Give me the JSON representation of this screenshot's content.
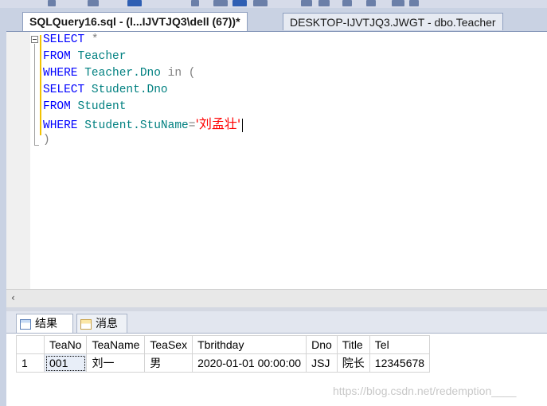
{
  "editor_tabs": [
    {
      "label": "SQLQuery16.sql - (l...IJVTJQ3\\dell (67))*",
      "active": true
    },
    {
      "label": "DESKTOP-IJVTJQ3.JWGT - dbo.Teacher",
      "active": false
    }
  ],
  "code": {
    "line1": {
      "kw": "SELECT",
      "rest": " *"
    },
    "line2": {
      "kw": "FROM",
      "rest": " Teacher"
    },
    "line3": {
      "kw": "WHERE",
      "ident": " Teacher.Dno",
      "op": " in ("
    },
    "line4": {
      "kw": "SELECT",
      "rest": " Student.Dno"
    },
    "line5": {
      "kw": "FROM",
      "rest": " Student"
    },
    "line6": {
      "kw": "WHERE",
      "ident": " Student.StuName",
      "op": "=",
      "str": "'刘孟壮'"
    },
    "line7": {
      "op": ")"
    }
  },
  "result_tabs": {
    "results": "结果",
    "messages": "消息"
  },
  "grid": {
    "columns": [
      "TeaNo",
      "TeaName",
      "TeaSex",
      "Tbrithday",
      "Dno",
      "Title",
      "Tel"
    ],
    "rows": [
      {
        "num": "1",
        "cells": [
          "001",
          "刘一",
          "男",
          "2020-01-01 00:00:00",
          "JSJ",
          "院长",
          "12345678"
        ]
      }
    ]
  },
  "watermark": "https://blog.csdn.net/redemption____",
  "colors": {
    "keyword": "#0000ff",
    "identifier": "#008080",
    "string": "#ff0000",
    "operator": "#808080"
  }
}
